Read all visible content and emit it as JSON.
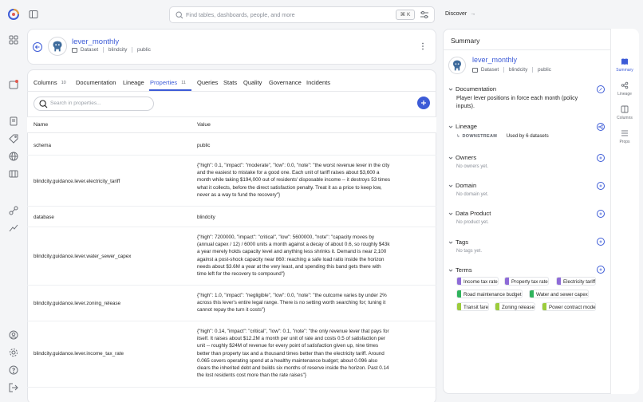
{
  "search": {
    "placeholder": "Find tables, dashboards, people, and more",
    "shortcut": "⌘ K"
  },
  "topbar": {
    "discover_label": "Discover",
    "discover_arrow": "→"
  },
  "entity": {
    "name": "lever_monthly",
    "type_label": "Dataset",
    "platform": "blindcity",
    "container": "public"
  },
  "tabs": [
    {
      "label": "Columns",
      "count": "10"
    },
    {
      "label": "Documentation"
    },
    {
      "label": "Lineage"
    },
    {
      "label": "Properties",
      "count": "11"
    },
    {
      "label": "Queries"
    },
    {
      "label": "Stats"
    },
    {
      "label": "Quality"
    },
    {
      "label": "Governance"
    },
    {
      "label": "Incidents"
    }
  ],
  "properties": {
    "search_placeholder": "Search in properties...",
    "header_name": "Name",
    "header_value": "Value",
    "rows": [
      {
        "name": "schema",
        "value": "public"
      },
      {
        "name": "blindcity.guidance.lever.electricity_tariff",
        "value": "{\"high\": 0.1, \"impact\": \"moderate\", \"low\": 0.0, \"note\": \"the worst revenue lever in the city and the easiest to mistake for a good one. Each unit of tariff raises about $3,600 a month while taking $194,000 out of residents' disposable income -- it destroys 53 times what it collects, before the direct satisfaction penalty. Treat it as a price to keep low, never as a way to fund the recovery\"}"
      },
      {
        "name": "database",
        "value": "blindcity"
      },
      {
        "name": "blindcity.guidance.lever.water_sewer_capex",
        "value": "{\"high\": 7200000, \"impact\": \"critical\", \"low\": 5600000, \"note\": \"capacity moves by (annual capex / 12) / 6000 units a month against a decay of about 0.6, so roughly $43k a year merely holds capacity level and anything less shrinks it. Demand is near 2,100 against a post-shock capacity near 860: reaching a safe load ratio inside the horizon needs about $3.6M a year at the very least, and spending this band gets there with time left for the recovery to compound\"}"
      },
      {
        "name": "blindcity.guidance.lever.zoning_release",
        "value": "{\"high\": 1.0, \"impact\": \"negligible\", \"low\": 0.0, \"note\": \"the outcome varies by under 2% across this lever's entire legal range. There is no setting worth searching for; tuning it cannot repay the turn it costs\"}"
      },
      {
        "name": "blindcity.guidance.lever.income_tax_rate",
        "value": "{\"high\": 0.14, \"impact\": \"critical\", \"low\": 0.1, \"note\": \"the only revenue lever that pays for itself. It raises about $12.2M a month per unit of rate and costs 0.5 of satisfaction per unit -- roughly $24M of revenue for every point of satisfaction given up, nine times better than property tax and a thousand times better than the electricity tariff. Around 0.065 covers operating spend at a healthy maintenance budget; about 0.096 also clears the inherited debt and builds six months of reserve inside the horizon. Past 0.14 the lost residents cost more than the rate raises\"}"
      }
    ]
  },
  "summary": {
    "title": "Summary",
    "documentation_title": "Documentation",
    "documentation_text": "Player lever positions in force each month (policy inputs).",
    "lineage_title": "Lineage",
    "downstream_label": "DOWNSTREAM",
    "downstream_text": "Used by 6 datasets",
    "owners_title": "Owners",
    "owners_empty": "No owners yet.",
    "domain_title": "Domain",
    "domain_empty": "No domain yet.",
    "data_product_title": "Data Product",
    "data_product_empty": "No product yet.",
    "tags_title": "Tags",
    "tags_empty": "No tags yet.",
    "terms_title": "Terms",
    "terms": [
      {
        "label": "Income tax rate",
        "color": "#8e6bd8"
      },
      {
        "label": "Property tax rate",
        "color": "#8e6bd8"
      },
      {
        "label": "Electricity tariff",
        "color": "#8e6bd8"
      },
      {
        "label": "Road maintenance budget",
        "color": "#2fb35c"
      },
      {
        "label": "Water and sewer capex",
        "color": "#2fb35c"
      },
      {
        "label": "Transit fare",
        "color": "#9ccc3c"
      },
      {
        "label": "Zoning release",
        "color": "#9ccc3c"
      },
      {
        "label": "Power contract mode",
        "color": "#9ccc3c"
      }
    ]
  },
  "rail": [
    {
      "label": "Summary"
    },
    {
      "label": "Lineage"
    },
    {
      "label": "Columns"
    },
    {
      "label": "Props"
    }
  ],
  "colors": {
    "accent": "#3c5bd7",
    "background": "#f4f5f7"
  }
}
